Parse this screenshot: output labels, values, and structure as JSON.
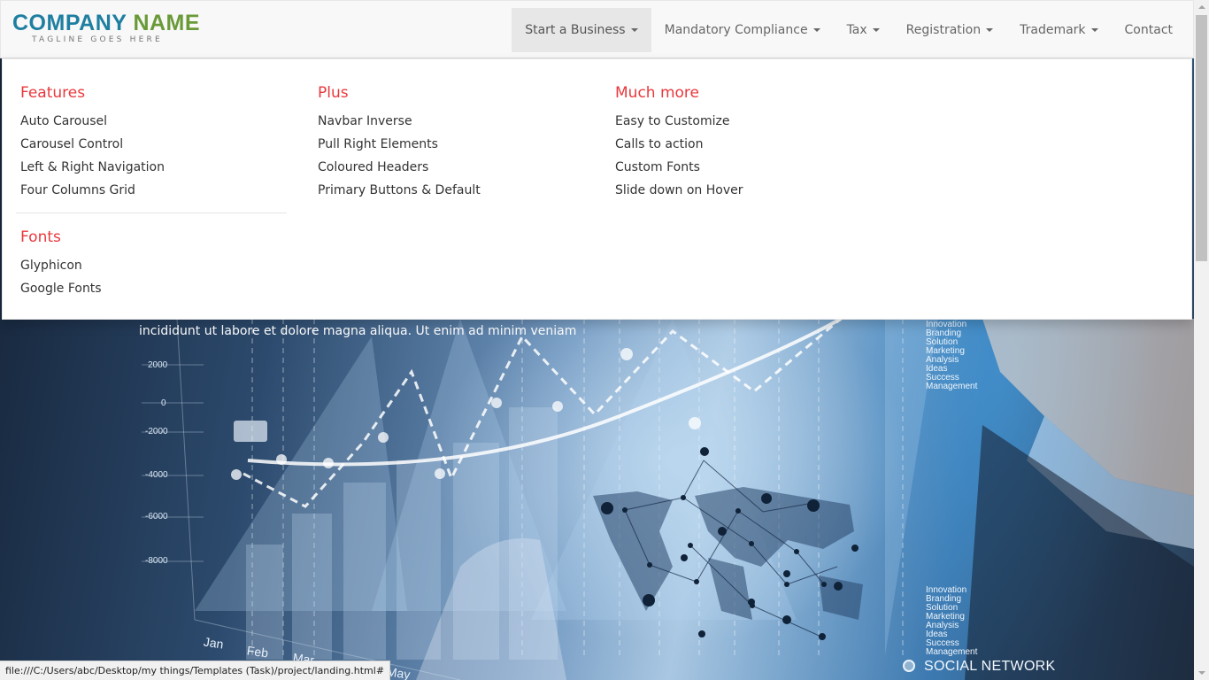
{
  "brand": {
    "name_part1": "COMPANY",
    "name_part2": "NAME",
    "tagline": "TAGLINE GOES HERE"
  },
  "nav": {
    "items": [
      {
        "label": "Start a Business",
        "dropdown": true,
        "active": true
      },
      {
        "label": "Mandatory Compliance",
        "dropdown": true
      },
      {
        "label": "Tax",
        "dropdown": true
      },
      {
        "label": "Registration",
        "dropdown": true
      },
      {
        "label": "Trademark",
        "dropdown": true
      },
      {
        "label": "Contact",
        "dropdown": false
      }
    ]
  },
  "mega_menu": {
    "features": {
      "title": "Features",
      "links": [
        "Auto Carousel",
        "Carousel Control",
        "Left & Right Navigation",
        "Four Columns Grid"
      ]
    },
    "fonts": {
      "title": "Fonts",
      "links": [
        "Glyphicon",
        "Google Fonts"
      ]
    },
    "plus": {
      "title": "Plus",
      "links": [
        "Navbar Inverse",
        "Pull Right Elements",
        "Coloured Headers",
        "Primary Buttons & Default"
      ]
    },
    "much_more": {
      "title": "Much more",
      "links": [
        "Easy to Customize",
        "Calls to action",
        "Custom Fonts",
        "Slide down on Hover"
      ]
    }
  },
  "hero": {
    "text_line": "incididunt ut labore et dolore magna aliqua. Ut enim ad minim veniam",
    "y_axis_labels": [
      "2000",
      "0",
      "-2000",
      "-4000",
      "-6000",
      "-8000"
    ],
    "month_labels": [
      "Jan",
      "Feb",
      "Mar",
      "May"
    ],
    "side_list_top": [
      "Innovation",
      "Branding",
      "Solution",
      "Marketing",
      "Analysis",
      "Ideas",
      "Success",
      "Management"
    ],
    "side_list_bottom": [
      "Innovation",
      "Branding",
      "Solution",
      "Marketing",
      "Analysis",
      "Ideas",
      "Success",
      "Management"
    ],
    "social_network": "SOCIAL NETWORK"
  },
  "status_bar": {
    "url": "file:///C:/Users/abc/Desktop/my things/Templates (Task)/project/landing.html#"
  },
  "colors": {
    "brand_blue": "#1f7fa1",
    "brand_green": "#6a9a38",
    "menu_heading": "#e8383d",
    "navbar_bg": "#f8f8f8",
    "active_nav_bg": "#e7e7e7"
  }
}
